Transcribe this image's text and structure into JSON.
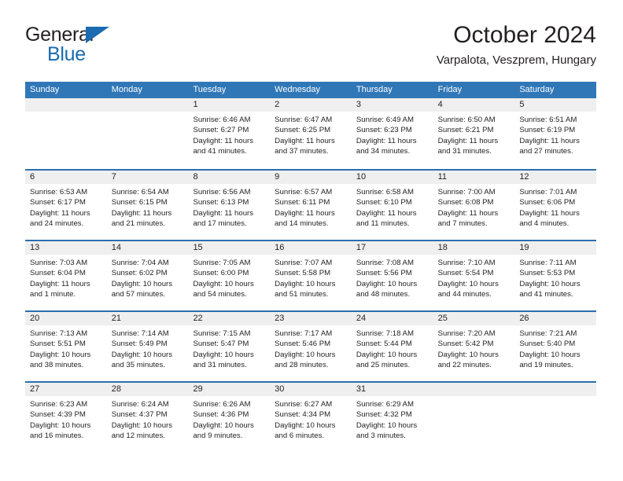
{
  "logo": {
    "word1": "General",
    "word2": "Blue",
    "triangle_color": "#1a6bb0"
  },
  "header": {
    "title": "October 2024",
    "subtitle": "Varpalota, Veszprem, Hungary"
  },
  "colors": {
    "header_blue": "#3077b7",
    "row_divider_blue": "#2c6fae",
    "day_number_band": "#efefef",
    "text": "#231f20"
  },
  "weekdays": [
    "Sunday",
    "Monday",
    "Tuesday",
    "Wednesday",
    "Thursday",
    "Friday",
    "Saturday"
  ],
  "weeks": [
    [
      {
        "day": "",
        "empty": true
      },
      {
        "day": "",
        "empty": true
      },
      {
        "day": "1",
        "sunrise": "Sunrise: 6:46 AM",
        "sunset": "Sunset: 6:27 PM",
        "daylight1": "Daylight: 11 hours",
        "daylight2": "and 41 minutes."
      },
      {
        "day": "2",
        "sunrise": "Sunrise: 6:47 AM",
        "sunset": "Sunset: 6:25 PM",
        "daylight1": "Daylight: 11 hours",
        "daylight2": "and 37 minutes."
      },
      {
        "day": "3",
        "sunrise": "Sunrise: 6:49 AM",
        "sunset": "Sunset: 6:23 PM",
        "daylight1": "Daylight: 11 hours",
        "daylight2": "and 34 minutes."
      },
      {
        "day": "4",
        "sunrise": "Sunrise: 6:50 AM",
        "sunset": "Sunset: 6:21 PM",
        "daylight1": "Daylight: 11 hours",
        "daylight2": "and 31 minutes."
      },
      {
        "day": "5",
        "sunrise": "Sunrise: 6:51 AM",
        "sunset": "Sunset: 6:19 PM",
        "daylight1": "Daylight: 11 hours",
        "daylight2": "and 27 minutes."
      }
    ],
    [
      {
        "day": "6",
        "sunrise": "Sunrise: 6:53 AM",
        "sunset": "Sunset: 6:17 PM",
        "daylight1": "Daylight: 11 hours",
        "daylight2": "and 24 minutes."
      },
      {
        "day": "7",
        "sunrise": "Sunrise: 6:54 AM",
        "sunset": "Sunset: 6:15 PM",
        "daylight1": "Daylight: 11 hours",
        "daylight2": "and 21 minutes."
      },
      {
        "day": "8",
        "sunrise": "Sunrise: 6:56 AM",
        "sunset": "Sunset: 6:13 PM",
        "daylight1": "Daylight: 11 hours",
        "daylight2": "and 17 minutes."
      },
      {
        "day": "9",
        "sunrise": "Sunrise: 6:57 AM",
        "sunset": "Sunset: 6:11 PM",
        "daylight1": "Daylight: 11 hours",
        "daylight2": "and 14 minutes."
      },
      {
        "day": "10",
        "sunrise": "Sunrise: 6:58 AM",
        "sunset": "Sunset: 6:10 PM",
        "daylight1": "Daylight: 11 hours",
        "daylight2": "and 11 minutes."
      },
      {
        "day": "11",
        "sunrise": "Sunrise: 7:00 AM",
        "sunset": "Sunset: 6:08 PM",
        "daylight1": "Daylight: 11 hours",
        "daylight2": "and 7 minutes."
      },
      {
        "day": "12",
        "sunrise": "Sunrise: 7:01 AM",
        "sunset": "Sunset: 6:06 PM",
        "daylight1": "Daylight: 11 hours",
        "daylight2": "and 4 minutes."
      }
    ],
    [
      {
        "day": "13",
        "sunrise": "Sunrise: 7:03 AM",
        "sunset": "Sunset: 6:04 PM",
        "daylight1": "Daylight: 11 hours",
        "daylight2": "and 1 minute."
      },
      {
        "day": "14",
        "sunrise": "Sunrise: 7:04 AM",
        "sunset": "Sunset: 6:02 PM",
        "daylight1": "Daylight: 10 hours",
        "daylight2": "and 57 minutes."
      },
      {
        "day": "15",
        "sunrise": "Sunrise: 7:05 AM",
        "sunset": "Sunset: 6:00 PM",
        "daylight1": "Daylight: 10 hours",
        "daylight2": "and 54 minutes."
      },
      {
        "day": "16",
        "sunrise": "Sunrise: 7:07 AM",
        "sunset": "Sunset: 5:58 PM",
        "daylight1": "Daylight: 10 hours",
        "daylight2": "and 51 minutes."
      },
      {
        "day": "17",
        "sunrise": "Sunrise: 7:08 AM",
        "sunset": "Sunset: 5:56 PM",
        "daylight1": "Daylight: 10 hours",
        "daylight2": "and 48 minutes."
      },
      {
        "day": "18",
        "sunrise": "Sunrise: 7:10 AM",
        "sunset": "Sunset: 5:54 PM",
        "daylight1": "Daylight: 10 hours",
        "daylight2": "and 44 minutes."
      },
      {
        "day": "19",
        "sunrise": "Sunrise: 7:11 AM",
        "sunset": "Sunset: 5:53 PM",
        "daylight1": "Daylight: 10 hours",
        "daylight2": "and 41 minutes."
      }
    ],
    [
      {
        "day": "20",
        "sunrise": "Sunrise: 7:13 AM",
        "sunset": "Sunset: 5:51 PM",
        "daylight1": "Daylight: 10 hours",
        "daylight2": "and 38 minutes."
      },
      {
        "day": "21",
        "sunrise": "Sunrise: 7:14 AM",
        "sunset": "Sunset: 5:49 PM",
        "daylight1": "Daylight: 10 hours",
        "daylight2": "and 35 minutes."
      },
      {
        "day": "22",
        "sunrise": "Sunrise: 7:15 AM",
        "sunset": "Sunset: 5:47 PM",
        "daylight1": "Daylight: 10 hours",
        "daylight2": "and 31 minutes."
      },
      {
        "day": "23",
        "sunrise": "Sunrise: 7:17 AM",
        "sunset": "Sunset: 5:46 PM",
        "daylight1": "Daylight: 10 hours",
        "daylight2": "and 28 minutes."
      },
      {
        "day": "24",
        "sunrise": "Sunrise: 7:18 AM",
        "sunset": "Sunset: 5:44 PM",
        "daylight1": "Daylight: 10 hours",
        "daylight2": "and 25 minutes."
      },
      {
        "day": "25",
        "sunrise": "Sunrise: 7:20 AM",
        "sunset": "Sunset: 5:42 PM",
        "daylight1": "Daylight: 10 hours",
        "daylight2": "and 22 minutes."
      },
      {
        "day": "26",
        "sunrise": "Sunrise: 7:21 AM",
        "sunset": "Sunset: 5:40 PM",
        "daylight1": "Daylight: 10 hours",
        "daylight2": "and 19 minutes."
      }
    ],
    [
      {
        "day": "27",
        "sunrise": "Sunrise: 6:23 AM",
        "sunset": "Sunset: 4:39 PM",
        "daylight1": "Daylight: 10 hours",
        "daylight2": "and 16 minutes."
      },
      {
        "day": "28",
        "sunrise": "Sunrise: 6:24 AM",
        "sunset": "Sunset: 4:37 PM",
        "daylight1": "Daylight: 10 hours",
        "daylight2": "and 12 minutes."
      },
      {
        "day": "29",
        "sunrise": "Sunrise: 6:26 AM",
        "sunset": "Sunset: 4:36 PM",
        "daylight1": "Daylight: 10 hours",
        "daylight2": "and 9 minutes."
      },
      {
        "day": "30",
        "sunrise": "Sunrise: 6:27 AM",
        "sunset": "Sunset: 4:34 PM",
        "daylight1": "Daylight: 10 hours",
        "daylight2": "and 6 minutes."
      },
      {
        "day": "31",
        "sunrise": "Sunrise: 6:29 AM",
        "sunset": "Sunset: 4:32 PM",
        "daylight1": "Daylight: 10 hours",
        "daylight2": "and 3 minutes."
      },
      {
        "day": "",
        "empty": true
      },
      {
        "day": "",
        "empty": true
      }
    ]
  ]
}
